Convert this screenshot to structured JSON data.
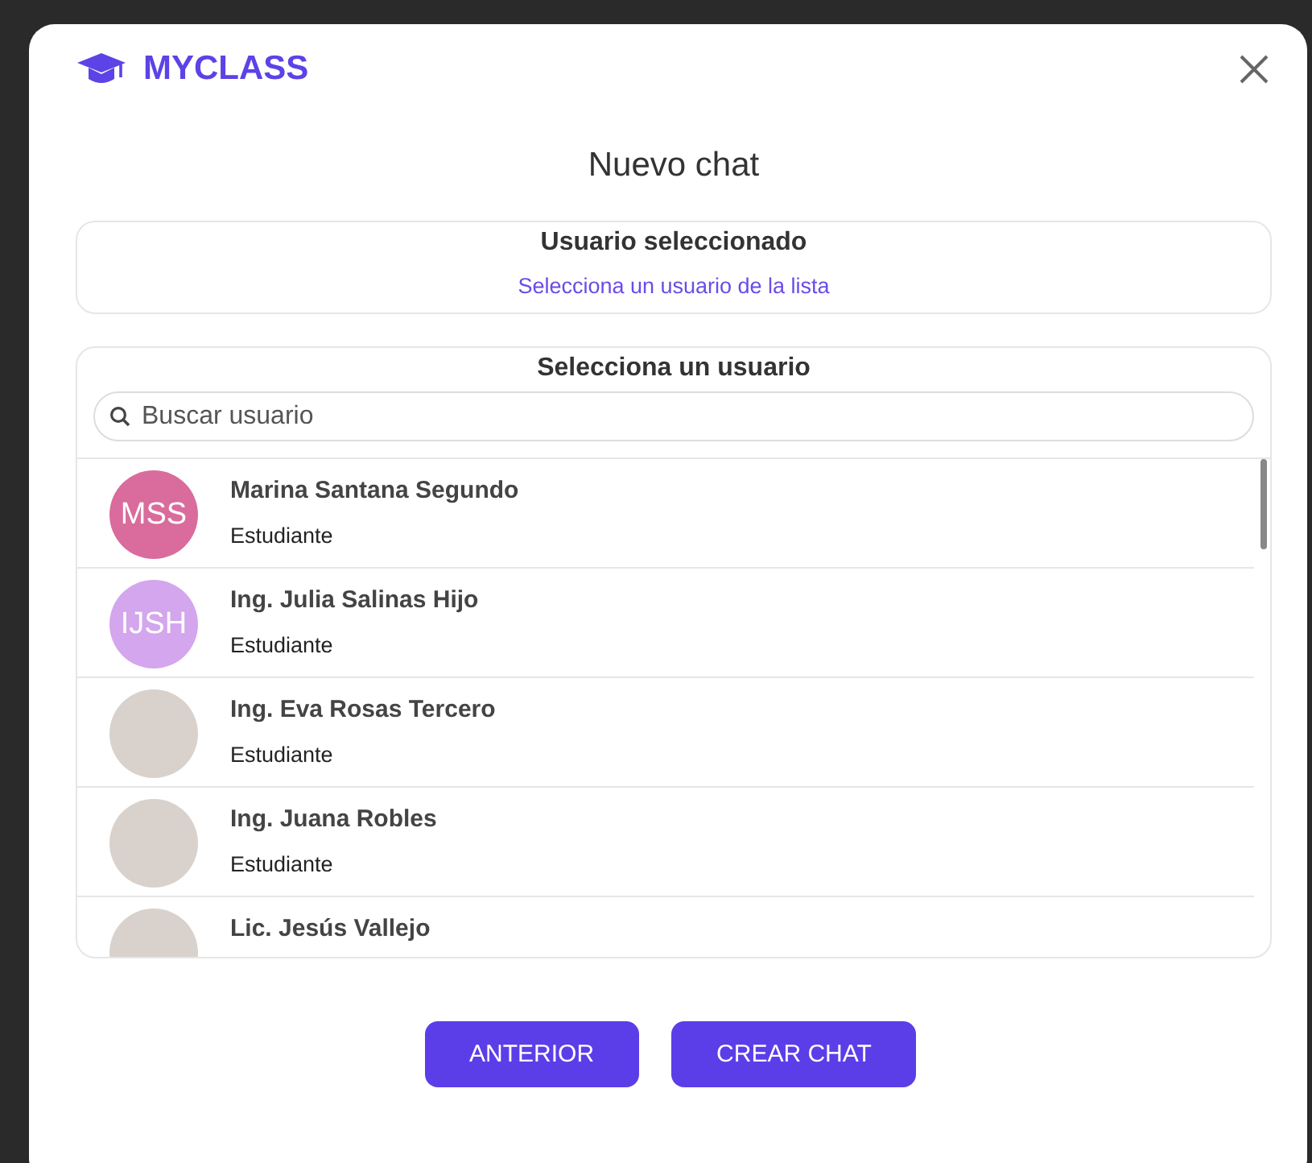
{
  "brand": {
    "name": "MYCLASS"
  },
  "dialog": {
    "title": "Nuevo chat"
  },
  "selected_user": {
    "heading": "Usuario seleccionado",
    "hint": "Selecciona un usuario de la lista"
  },
  "user_list": {
    "heading": "Selecciona un usuario",
    "search": {
      "placeholder": "Buscar usuario"
    },
    "users": [
      {
        "name": "Marina Santana Segundo",
        "role": "Estudiante",
        "avatar": {
          "kind": "initials",
          "text": "MSS",
          "color": "#d96c9c"
        }
      },
      {
        "name": "Ing. Julia Salinas Hijo",
        "role": "Estudiante",
        "avatar": {
          "kind": "initials",
          "text": "IJSH",
          "color": "#d4a6ee"
        }
      },
      {
        "name": "Ing. Eva Rosas Tercero",
        "role": "Estudiante",
        "avatar": {
          "kind": "photo"
        }
      },
      {
        "name": "Ing. Juana Robles",
        "role": "Estudiante",
        "avatar": {
          "kind": "photo"
        }
      },
      {
        "name": "Lic. Jesús Vallejo",
        "avatar": {
          "kind": "photo"
        }
      }
    ]
  },
  "buttons": [
    "ANTERIOR",
    "CREAR CHAT"
  ]
}
